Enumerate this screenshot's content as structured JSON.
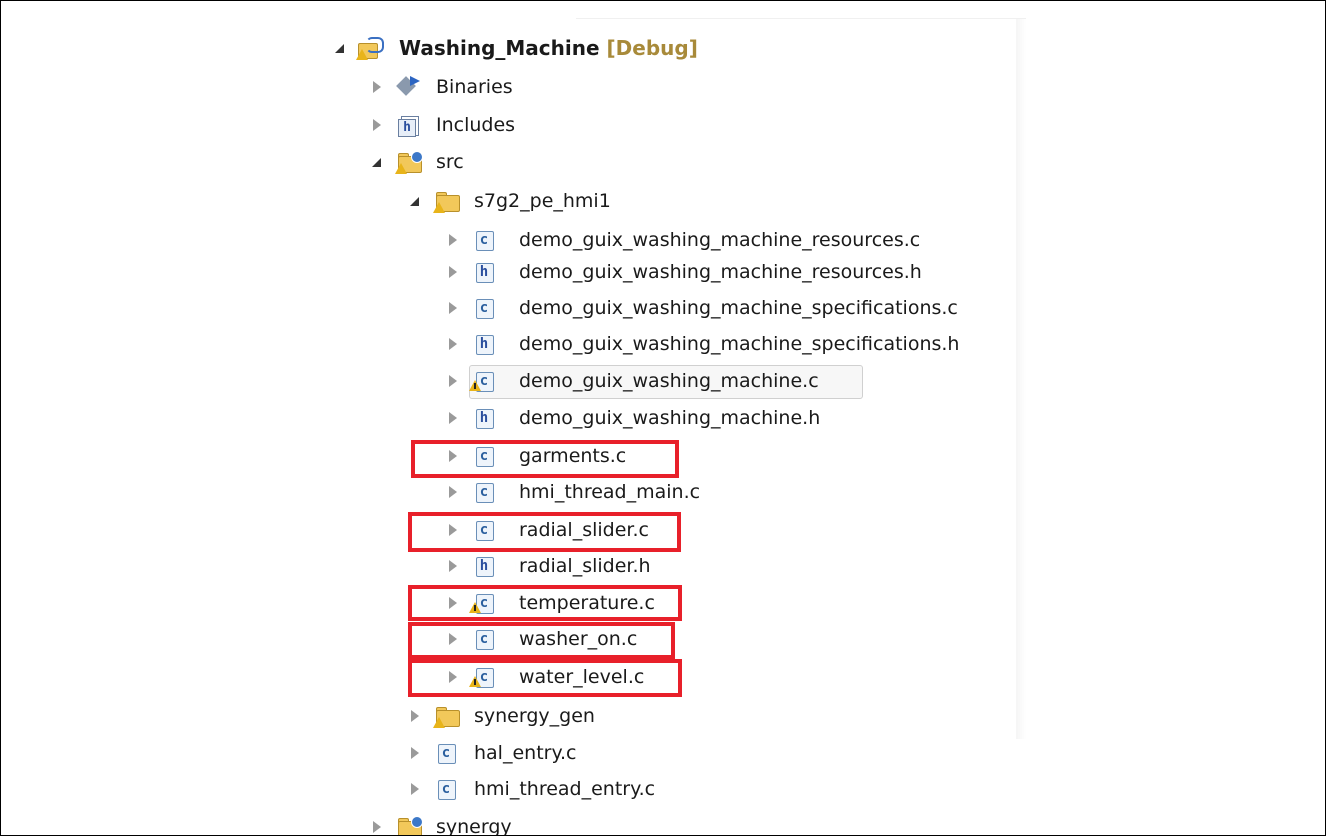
{
  "tree": {
    "project": {
      "name": "Washing_Machine",
      "config": "[Debug]"
    },
    "binaries": "Binaries",
    "includes": "Includes",
    "src": "src",
    "s7g2_folder": "s7g2_pe_hmi1",
    "files": [
      {
        "name": "demo_guix_washing_machine_resources.c",
        "type": "c",
        "warning": false,
        "highlighted": false
      },
      {
        "name": "demo_guix_washing_machine_resources.h",
        "type": "h",
        "warning": false,
        "highlighted": false
      },
      {
        "name": "demo_guix_washing_machine_specifications.c",
        "type": "c",
        "warning": false,
        "highlighted": false
      },
      {
        "name": "demo_guix_washing_machine_specifications.h",
        "type": "h",
        "warning": false,
        "highlighted": false
      },
      {
        "name": "demo_guix_washing_machine.c",
        "type": "c",
        "warning": true,
        "highlighted": false,
        "selected": true
      },
      {
        "name": "demo_guix_washing_machine.h",
        "type": "h",
        "warning": false,
        "highlighted": false
      },
      {
        "name": "garments.c",
        "type": "c",
        "warning": false,
        "highlighted": true
      },
      {
        "name": "hmi_thread_main.c",
        "type": "c",
        "warning": false,
        "highlighted": false
      },
      {
        "name": "radial_slider.c",
        "type": "c",
        "warning": false,
        "highlighted": true
      },
      {
        "name": "radial_slider.h",
        "type": "h",
        "warning": false,
        "highlighted": false
      },
      {
        "name": "temperature.c",
        "type": "c",
        "warning": true,
        "highlighted": true
      },
      {
        "name": "washer_on.c",
        "type": "c",
        "warning": false,
        "highlighted": true
      },
      {
        "name": "water_level.c",
        "type": "c",
        "warning": true,
        "highlighted": true
      }
    ],
    "synergy_gen": "synergy_gen",
    "hal_entry": "hal_entry.c",
    "hmi_thread_entry": "hmi_thread_entry.c",
    "synergy": "synergy"
  },
  "icons": {
    "file_c_letter": "c",
    "file_h_letter": "h"
  },
  "colors": {
    "highlight": "#e8202a",
    "debug_label": "#a88a3a"
  }
}
